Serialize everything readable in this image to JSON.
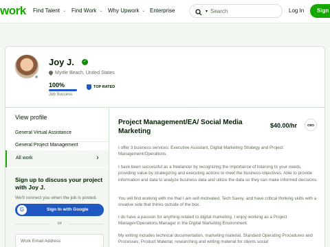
{
  "header": {
    "logo": "work",
    "nav": [
      "Find Talent",
      "Find Work",
      "Why Upwork",
      "Enterprise"
    ],
    "search_placeholder": "Search",
    "login": "Log In",
    "signup": "Sign"
  },
  "profile": {
    "name": "Joy J.",
    "location": "Myrtle Beach, United States",
    "job_success_value": "100%",
    "job_success_fraction": 1.0,
    "job_success_label": "Job Success",
    "badge": "TOP RATED"
  },
  "sidebar": {
    "title": "View profile",
    "items": [
      "General Virtual Assistance",
      "General Project Management"
    ],
    "all_work": "All work",
    "signup_title": "Sign up to discuss your project with Joy J.",
    "signup_note": "We'll connect you when the job is posted.",
    "google_label": "Sign In with Google",
    "or": "or",
    "email_placeholder": "Work Email Address"
  },
  "content": {
    "title": "Project Management/EA/ Social Media Marketing",
    "rate": "$40.00/hr",
    "paragraphs": [
      "I offer 3 business services: Executive Assistant, Digital Marketing Strategy and Project Management/Operations.",
      "I have been successful as a freelancer by recognizing the importance of listening to your needs, providing value by strategizing and executing actions to meet the business objectives. Able to provide information and data to analyze business data and utilize the data so they can make informed decisions.",
      "You will find working with me that I am self-motivated, Tech Savvy, and have critical thinking skills with a creative side that thinks outside of the box.",
      "I do have a passion for anything related to digital marketing. I enjoy working as a Project Manager/Operations Manager in the Digital Marketing Environment.",
      "My writing includes technical documentation, marketing material, Standard Operating Procedures and Processes, Product Material, researching and writing material for clients social"
    ]
  }
}
